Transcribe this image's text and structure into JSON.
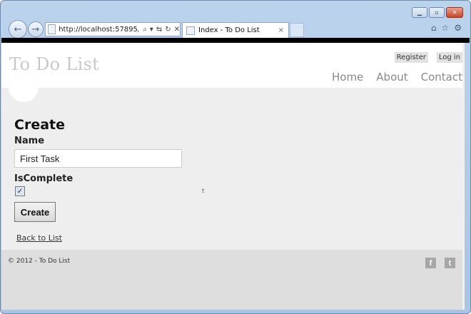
{
  "browser": {
    "address_url": "http://localhost:57895/",
    "tab_title": "Index - To Do List",
    "tab_close": "×",
    "back_glyph": "←",
    "forward_glyph": "→",
    "tools": [
      "⌕",
      "▾",
      "⇆",
      "↻",
      "✕"
    ],
    "right_tools": [
      "⌂",
      "☆",
      "⚙"
    ],
    "window_controls": {
      "minimize": "▁",
      "maximize": "▫",
      "close": "✕"
    }
  },
  "header": {
    "site_title": "To Do List",
    "register_label": "Register",
    "login_label": "Log in",
    "menu": [
      "Home",
      "About",
      "Contact"
    ]
  },
  "form": {
    "heading": "Create",
    "name_label": "Name",
    "name_value": "First Task",
    "iscomplete_label": "IsComplete",
    "iscomplete_checked": true,
    "checkbox_glyph": "✓",
    "stray_mark": "t",
    "create_label": "Create",
    "back_link": "Back to List"
  },
  "footer": {
    "copyright": "© 2012 - To Do List",
    "facebook_glyph": "f",
    "twitter_glyph": "t"
  },
  "colors": {
    "title_gray": "#c8c8c8",
    "content_bg": "#efeeef",
    "footer_bg": "#dedede",
    "window_frame": "#bcd3ec"
  }
}
